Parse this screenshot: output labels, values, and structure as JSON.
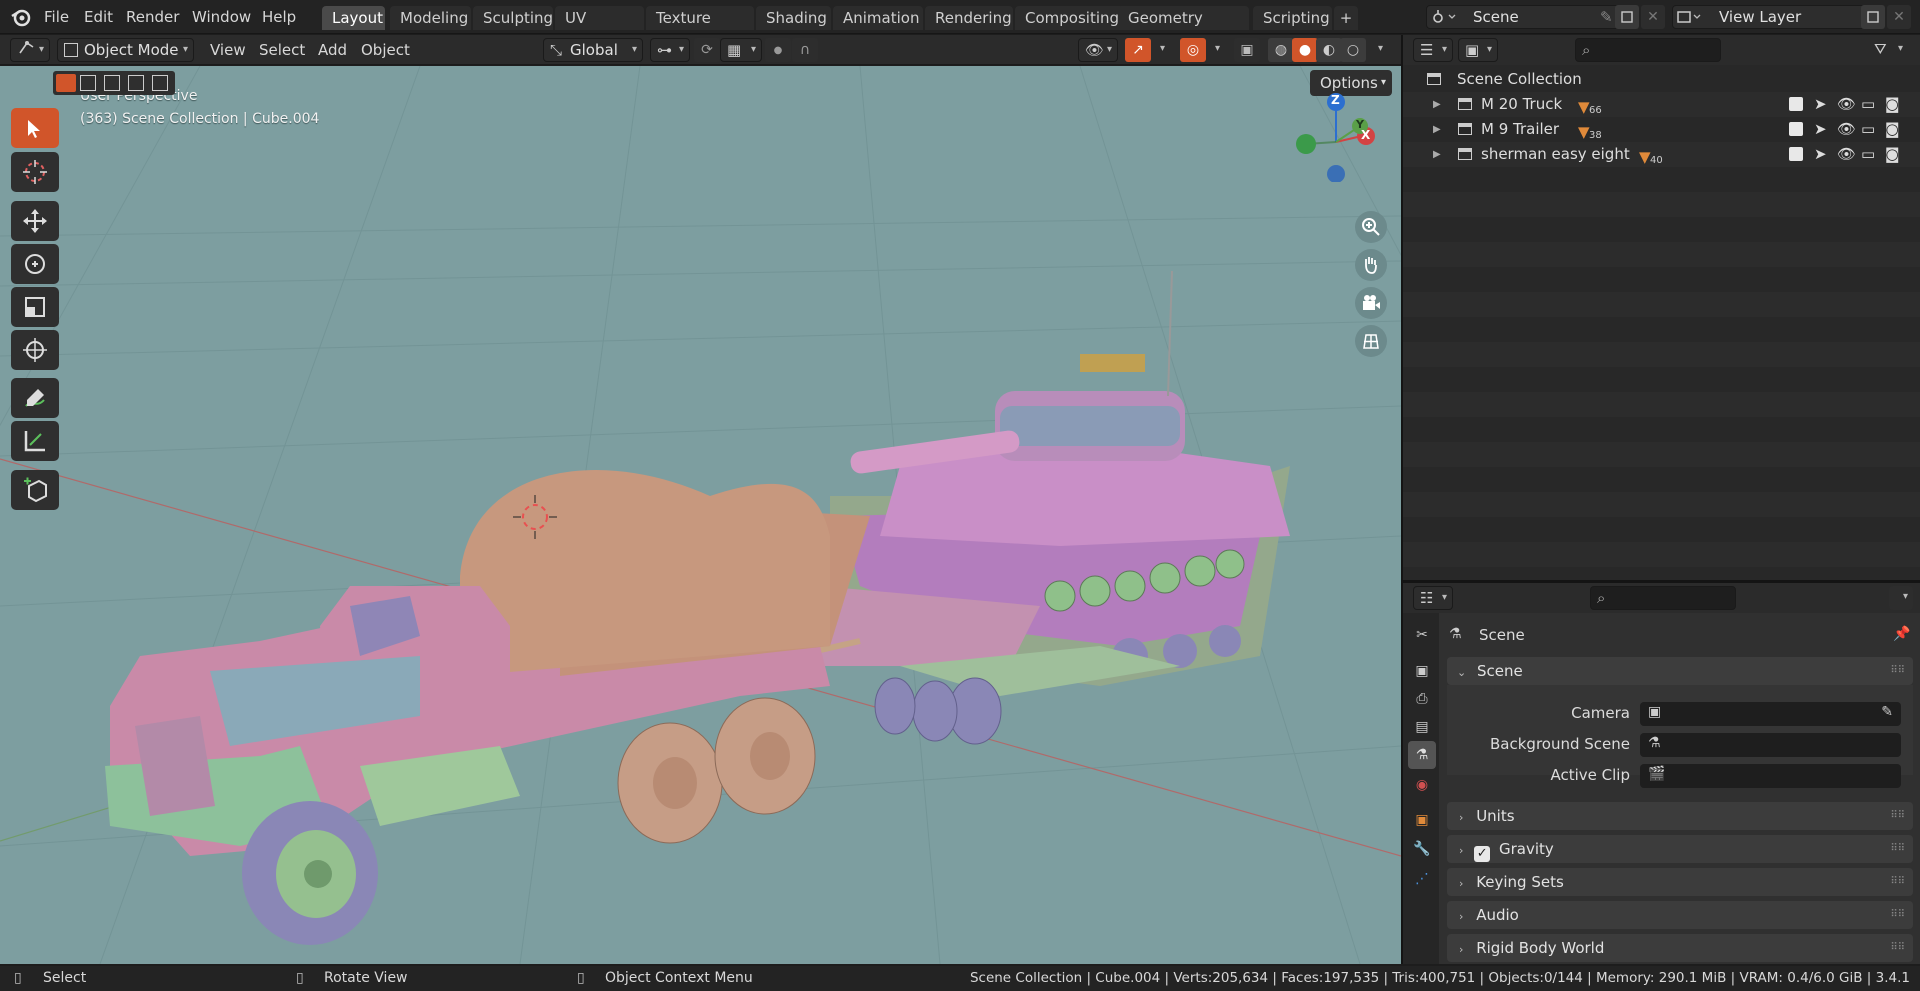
{
  "app": {
    "logo_icon": "blender-logo-icon"
  },
  "menu": [
    "File",
    "Edit",
    "Render",
    "Window",
    "Help"
  ],
  "workspaces": [
    "Layout",
    "Modeling",
    "Sculpting",
    "UV Editing",
    "Texture Paint",
    "Shading",
    "Animation",
    "Rendering",
    "Compositing",
    "Geometry Nodes",
    "Scripting"
  ],
  "active_workspace": "Layout",
  "scene_selector": {
    "value": "Scene"
  },
  "view_layer_selector": {
    "value": "View Layer"
  },
  "viewport_header": {
    "mode": "Object Mode",
    "menus": [
      "View",
      "Select",
      "Add",
      "Object"
    ],
    "transform_orientation": "Global",
    "options_label": "Options"
  },
  "viewport": {
    "perspective_label": "User Perspective",
    "collection_label": "(363) Scene Collection | Cube.004",
    "gizmo": {
      "z": "Z",
      "y": "Y",
      "x": "X"
    },
    "background_color": "#7d9ea0"
  },
  "toolbar_tools": [
    "select-box-icon",
    "cursor-icon",
    "move-icon",
    "rotate-icon",
    "scale-icon",
    "transform-icon",
    "annotate-icon",
    "measure-icon",
    "add-cube-icon"
  ],
  "outliner": {
    "root": "Scene Collection",
    "items": [
      {
        "name": "M 20 Truck",
        "badge": "66"
      },
      {
        "name": "M 9 Trailer",
        "badge": "38"
      },
      {
        "name": "sherman easy eight",
        "badge": "40"
      }
    ]
  },
  "properties": {
    "context_title": "Scene",
    "scene_panel": "Scene",
    "fields": [
      {
        "label": "Camera"
      },
      {
        "label": "Background Scene"
      },
      {
        "label": "Active Clip"
      }
    ],
    "panels": [
      "Units",
      "Gravity",
      "Keying Sets",
      "Audio",
      "Rigid Body World"
    ],
    "gravity_enabled": true
  },
  "statusbar": {
    "left_hint": "Select",
    "mid_hint": "Rotate View",
    "right_hint": "Object Context Menu",
    "stats": "Scene Collection | Cube.004 | Verts:205,634 | Faces:197,535 | Tris:400,751 | Objects:0/144 | Memory: 290.1 MiB | VRAM: 0.4/6.0 GiB | 3.4.1"
  },
  "colors": {
    "accent": "#d1552a",
    "truck": "#c98aa8",
    "canvas": "#c4927a",
    "tank": "#b37dbd"
  }
}
